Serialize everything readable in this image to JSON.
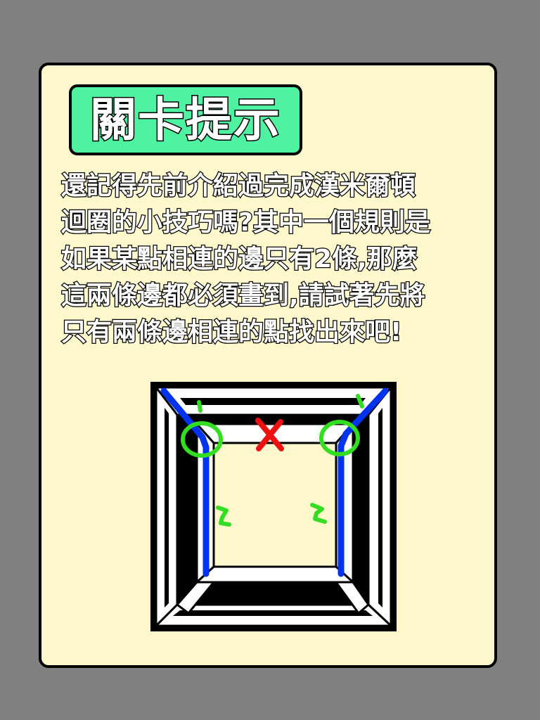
{
  "hint_card": {
    "title": "關卡提示",
    "lines": [
      "還記得先前介紹過完成漢米爾頓",
      "迴圈的小技巧嗎?其中一個規則是",
      "如果某點相連的邊只有2條,那麼",
      "這兩條邊都必須畫到,請試著先將",
      "只有兩條邊相連的點找出來吧!"
    ]
  },
  "diagram": {
    "annotations": {
      "left_corner_count": "1",
      "right_corner_count": "1",
      "left_edge_count": "2",
      "right_edge_count": "2"
    },
    "colors": {
      "path": "#0033EE",
      "circle": "#33DD22",
      "cross": "#EE1111",
      "edge_fill": "#FFFFFF",
      "edge_stroke": "#000000"
    }
  }
}
